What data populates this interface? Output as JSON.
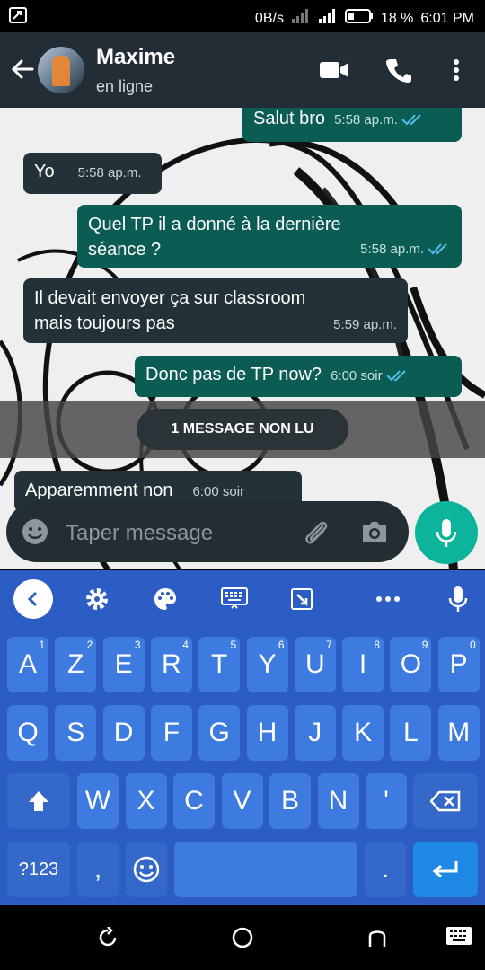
{
  "statusbar": {
    "data": "0B/s",
    "battery": "18 %",
    "time": "6:01 PM"
  },
  "header": {
    "name": "Maxime",
    "status": "en ligne"
  },
  "messages": [
    {
      "dir": "out",
      "text": "Salut bro",
      "time": "5:58 ap.m.",
      "read": true
    },
    {
      "dir": "in",
      "text": "Yo",
      "time": "5:58 ap.m."
    },
    {
      "dir": "out",
      "line1": "Quel TP il a donné à la dernière",
      "line2": "séance ?",
      "time": "5:58 ap.m.",
      "read": true
    },
    {
      "dir": "in",
      "line1": "Il devait envoyer ça sur classroom",
      "line2": "mais toujours pas",
      "time": "5:59 ap.m."
    },
    {
      "dir": "out",
      "text": "Donc pas de TP now?",
      "time": "6:00 soir",
      "read": true
    },
    {
      "dir": "in",
      "text": "Apparemment non",
      "time": "6:00 soir"
    }
  ],
  "unread_label": "1 MESSAGE NON LU",
  "composer": {
    "placeholder": "Taper message"
  },
  "keyboard": {
    "row1": [
      {
        "k": "A",
        "n": "1"
      },
      {
        "k": "Z",
        "n": "2"
      },
      {
        "k": "E",
        "n": "3"
      },
      {
        "k": "R",
        "n": "4"
      },
      {
        "k": "T",
        "n": "5"
      },
      {
        "k": "Y",
        "n": "6"
      },
      {
        "k": "U",
        "n": "7"
      },
      {
        "k": "I",
        "n": "8"
      },
      {
        "k": "O",
        "n": "9"
      },
      {
        "k": "P",
        "n": "0"
      }
    ],
    "row2": [
      "Q",
      "S",
      "D",
      "F",
      "G",
      "H",
      "J",
      "K",
      "L",
      "M"
    ],
    "row3": [
      "W",
      "X",
      "C",
      "V",
      "B",
      "N",
      "'"
    ],
    "sym": "?123",
    "comma": ",",
    "period": "."
  }
}
